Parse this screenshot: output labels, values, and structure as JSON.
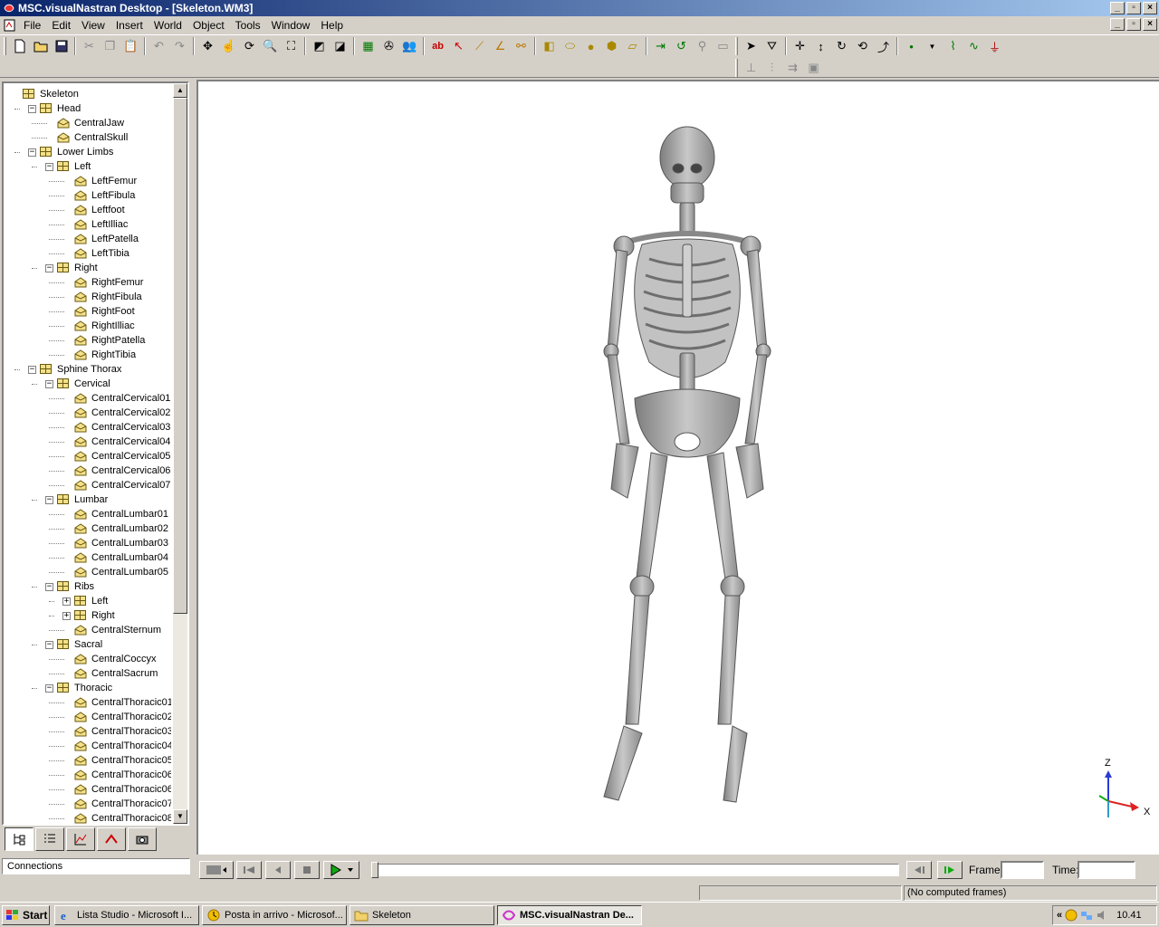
{
  "window": {
    "title": "MSC.visualNastran Desktop - [Skeleton.WM3]",
    "min_glyph": "_",
    "max_glyph": "▫",
    "close_glyph": "×"
  },
  "menu": [
    "File",
    "Edit",
    "View",
    "Insert",
    "World",
    "Object",
    "Tools",
    "Window",
    "Help"
  ],
  "tree": {
    "rows": [
      {
        "label": "Skeleton",
        "depth": 0,
        "expander": "",
        "icon": "assembly"
      },
      {
        "label": "Head",
        "depth": 1,
        "expander": "−",
        "icon": "assembly"
      },
      {
        "label": "CentralJaw",
        "depth": 2,
        "expander": "",
        "icon": "body"
      },
      {
        "label": "CentralSkull",
        "depth": 2,
        "expander": "",
        "icon": "body"
      },
      {
        "label": "Lower Limbs",
        "depth": 1,
        "expander": "−",
        "icon": "assembly"
      },
      {
        "label": "Left",
        "depth": 2,
        "expander": "−",
        "icon": "assembly"
      },
      {
        "label": "LeftFemur",
        "depth": 3,
        "expander": "",
        "icon": "body"
      },
      {
        "label": "LeftFibula",
        "depth": 3,
        "expander": "",
        "icon": "body"
      },
      {
        "label": "Leftfoot",
        "depth": 3,
        "expander": "",
        "icon": "body"
      },
      {
        "label": "LeftIlliac",
        "depth": 3,
        "expander": "",
        "icon": "body"
      },
      {
        "label": "LeftPatella",
        "depth": 3,
        "expander": "",
        "icon": "body"
      },
      {
        "label": "LeftTibia",
        "depth": 3,
        "expander": "",
        "icon": "body"
      },
      {
        "label": "Right",
        "depth": 2,
        "expander": "−",
        "icon": "assembly"
      },
      {
        "label": "RightFemur",
        "depth": 3,
        "expander": "",
        "icon": "body"
      },
      {
        "label": "RightFibula",
        "depth": 3,
        "expander": "",
        "icon": "body"
      },
      {
        "label": "RightFoot",
        "depth": 3,
        "expander": "",
        "icon": "body"
      },
      {
        "label": "RightIlliac",
        "depth": 3,
        "expander": "",
        "icon": "body"
      },
      {
        "label": "RightPatella",
        "depth": 3,
        "expander": "",
        "icon": "body"
      },
      {
        "label": "RightTibia",
        "depth": 3,
        "expander": "",
        "icon": "body"
      },
      {
        "label": "Sphine Thorax",
        "depth": 1,
        "expander": "−",
        "icon": "assembly"
      },
      {
        "label": "Cervical",
        "depth": 2,
        "expander": "−",
        "icon": "assembly"
      },
      {
        "label": "CentralCervical01",
        "depth": 3,
        "expander": "",
        "icon": "body"
      },
      {
        "label": "CentralCervical02",
        "depth": 3,
        "expander": "",
        "icon": "body"
      },
      {
        "label": "CentralCervical03",
        "depth": 3,
        "expander": "",
        "icon": "body"
      },
      {
        "label": "CentralCervical04",
        "depth": 3,
        "expander": "",
        "icon": "body"
      },
      {
        "label": "CentralCervical05",
        "depth": 3,
        "expander": "",
        "icon": "body"
      },
      {
        "label": "CentralCervical06",
        "depth": 3,
        "expander": "",
        "icon": "body"
      },
      {
        "label": "CentralCervical07",
        "depth": 3,
        "expander": "",
        "icon": "body"
      },
      {
        "label": "Lumbar",
        "depth": 2,
        "expander": "−",
        "icon": "assembly"
      },
      {
        "label": "CentralLumbar01",
        "depth": 3,
        "expander": "",
        "icon": "body"
      },
      {
        "label": "CentralLumbar02",
        "depth": 3,
        "expander": "",
        "icon": "body"
      },
      {
        "label": "CentralLumbar03",
        "depth": 3,
        "expander": "",
        "icon": "body"
      },
      {
        "label": "CentralLumbar04",
        "depth": 3,
        "expander": "",
        "icon": "body"
      },
      {
        "label": "CentralLumbar05",
        "depth": 3,
        "expander": "",
        "icon": "body"
      },
      {
        "label": "Ribs",
        "depth": 2,
        "expander": "−",
        "icon": "assembly"
      },
      {
        "label": "Left",
        "depth": 3,
        "expander": "+",
        "icon": "assembly"
      },
      {
        "label": "Right",
        "depth": 3,
        "expander": "+",
        "icon": "assembly"
      },
      {
        "label": "CentralSternum",
        "depth": 3,
        "expander": "",
        "icon": "body"
      },
      {
        "label": "Sacral",
        "depth": 2,
        "expander": "−",
        "icon": "assembly"
      },
      {
        "label": "CentralCoccyx",
        "depth": 3,
        "expander": "",
        "icon": "body"
      },
      {
        "label": "CentralSacrum",
        "depth": 3,
        "expander": "",
        "icon": "body"
      },
      {
        "label": "Thoracic",
        "depth": 2,
        "expander": "−",
        "icon": "assembly"
      },
      {
        "label": "CentralThoracic01",
        "depth": 3,
        "expander": "",
        "icon": "body"
      },
      {
        "label": "CentralThoracic02",
        "depth": 3,
        "expander": "",
        "icon": "body"
      },
      {
        "label": "CentralThoracic03",
        "depth": 3,
        "expander": "",
        "icon": "body"
      },
      {
        "label": "CentralThoracic04",
        "depth": 3,
        "expander": "",
        "icon": "body"
      },
      {
        "label": "CentralThoracic05",
        "depth": 3,
        "expander": "",
        "icon": "body"
      },
      {
        "label": "CentralThoracic06",
        "depth": 3,
        "expander": "",
        "icon": "body"
      },
      {
        "label": "CentralThoracic06",
        "depth": 3,
        "expander": "",
        "icon": "body"
      },
      {
        "label": "CentralThoracic07",
        "depth": 3,
        "expander": "",
        "icon": "body"
      },
      {
        "label": "CentralThoracic08",
        "depth": 3,
        "expander": "",
        "icon": "body"
      }
    ]
  },
  "panel": {
    "connections_label": "Connections"
  },
  "playback": {
    "frame_label": "Frame:",
    "time_label": "Time:",
    "frame_value": "",
    "time_value": ""
  },
  "status": {
    "computed_frames": "(No computed frames)"
  },
  "axes": {
    "z_label": "Z",
    "x_label": "X"
  },
  "taskbar": {
    "start_label": "Start",
    "tasks": [
      {
        "label": "Lista Studio - Microsoft I...",
        "active": false,
        "icon": "ie-icon"
      },
      {
        "label": "Posta in arrivo - Microsof...",
        "active": false,
        "icon": "outlook-icon"
      },
      {
        "label": "Skeleton",
        "active": false,
        "icon": "folder-icon"
      },
      {
        "label": "MSC.visualNastran De...",
        "active": true,
        "icon": "nastran-icon"
      }
    ],
    "clock": "10.41",
    "tray_chevron": "«"
  },
  "colors": {
    "titlebar_start": "#0a246a",
    "titlebar_end": "#a6caf0",
    "face": "#d4d0c8",
    "bone": "#b8b8b8"
  }
}
